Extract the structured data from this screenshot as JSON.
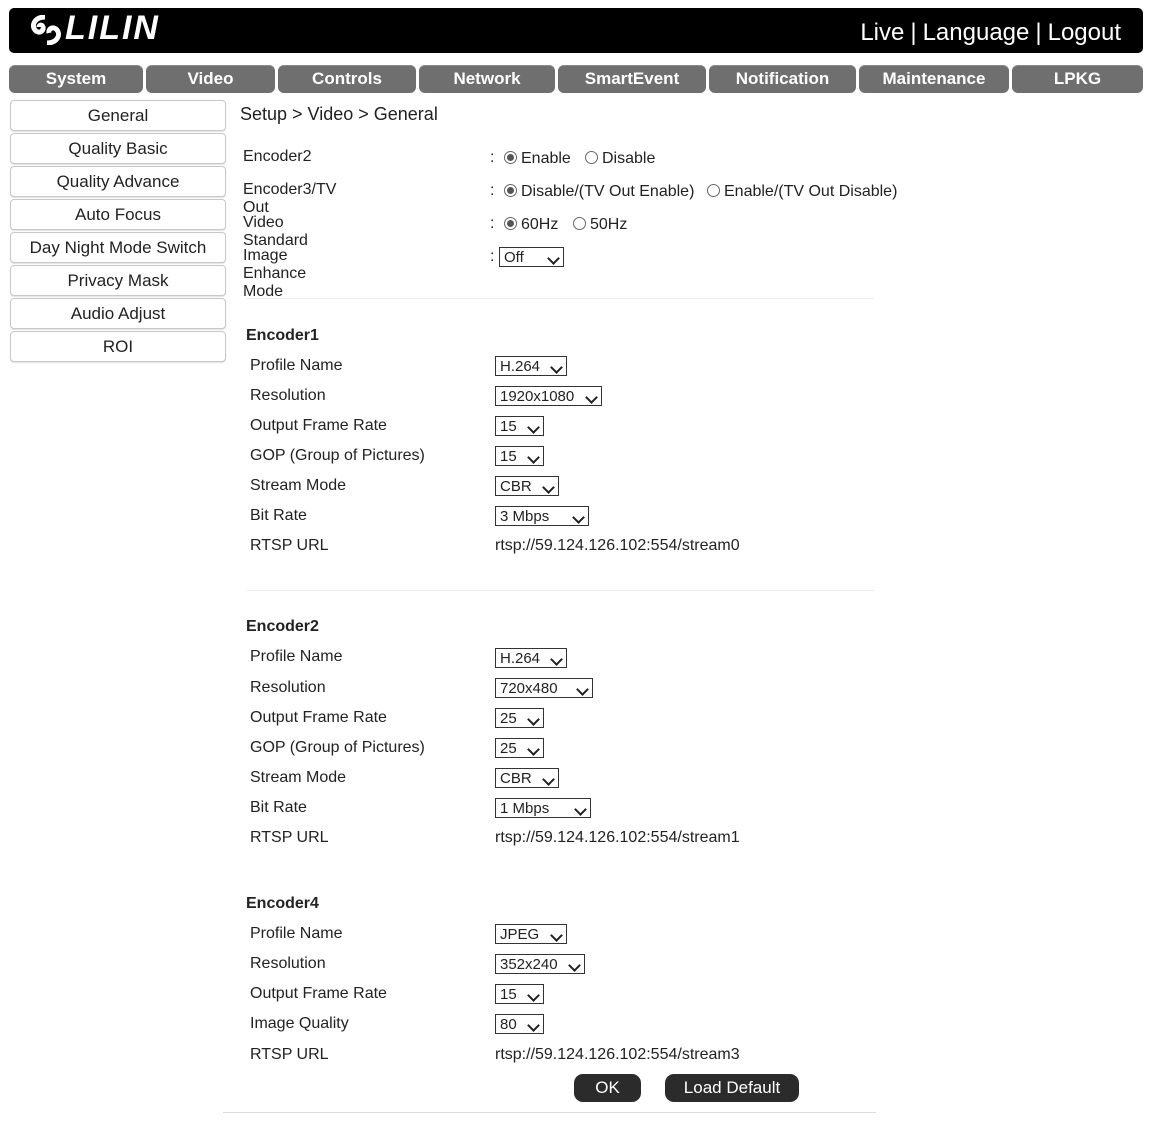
{
  "header": {
    "logo_text": "LILIN",
    "links": [
      "Live",
      "Language",
      "Logout"
    ]
  },
  "tabs": [
    "System",
    "Video",
    "Controls",
    "Network",
    "SmartEvent",
    "Notification",
    "Maintenance",
    "LPKG"
  ],
  "sidebar": {
    "items": [
      "General",
      "Quality Basic",
      "Quality Advance",
      "Auto Focus",
      "Day Night Mode Switch",
      "Privacy Mask",
      "Audio Adjust",
      "ROI"
    ]
  },
  "breadcrumb": "Setup > Video > General",
  "general": {
    "colon": ":",
    "encoder2": {
      "label": "Encoder2",
      "opt1": "Enable",
      "opt2": "Disable"
    },
    "encoder3": {
      "label": "Encoder3/TV Out",
      "opt1": "Disable/(TV Out Enable)",
      "opt2": "Enable/(TV Out Disable)"
    },
    "standard": {
      "label": "Video Standard",
      "opt1": "60Hz",
      "opt2": "50Hz"
    },
    "enhance": {
      "label": "Image Enhance Mode",
      "value": "Off"
    }
  },
  "encoder1": {
    "title": "Encoder1",
    "labels": {
      "profile": "Profile Name",
      "resolution": "Resolution",
      "fps": "Output Frame Rate",
      "gop": "GOP (Group of Pictures)",
      "mode": "Stream Mode",
      "bitrate": "Bit Rate",
      "rtsp": "RTSP URL"
    },
    "values": {
      "profile": "H.264",
      "resolution": "1920x1080",
      "fps": "15",
      "gop": "15",
      "mode": "CBR",
      "bitrate": "3 Mbps",
      "rtsp": "rtsp://59.124.126.102:554/stream0"
    }
  },
  "encoder2_cfg": {
    "title": "Encoder2",
    "labels": {
      "profile": "Profile Name",
      "resolution": "Resolution",
      "fps": "Output Frame Rate",
      "gop": "GOP (Group of Pictures)",
      "mode": "Stream Mode",
      "bitrate": "Bit Rate",
      "rtsp": "RTSP URL"
    },
    "values": {
      "profile": "H.264",
      "resolution": "720x480",
      "fps": "25",
      "gop": "25",
      "mode": "CBR",
      "bitrate": "1 Mbps",
      "rtsp": "rtsp://59.124.126.102:554/stream1"
    }
  },
  "encoder4": {
    "title": "Encoder4",
    "labels": {
      "profile": "Profile Name",
      "resolution": "Resolution",
      "fps": "Output Frame Rate",
      "quality": "Image Quality",
      "rtsp": "RTSP URL"
    },
    "values": {
      "profile": "JPEG",
      "resolution": "352x240",
      "fps": "15",
      "quality": "80",
      "rtsp": "rtsp://59.124.126.102:554/stream3"
    }
  },
  "buttons": {
    "ok": "OK",
    "load_default": "Load Default"
  }
}
